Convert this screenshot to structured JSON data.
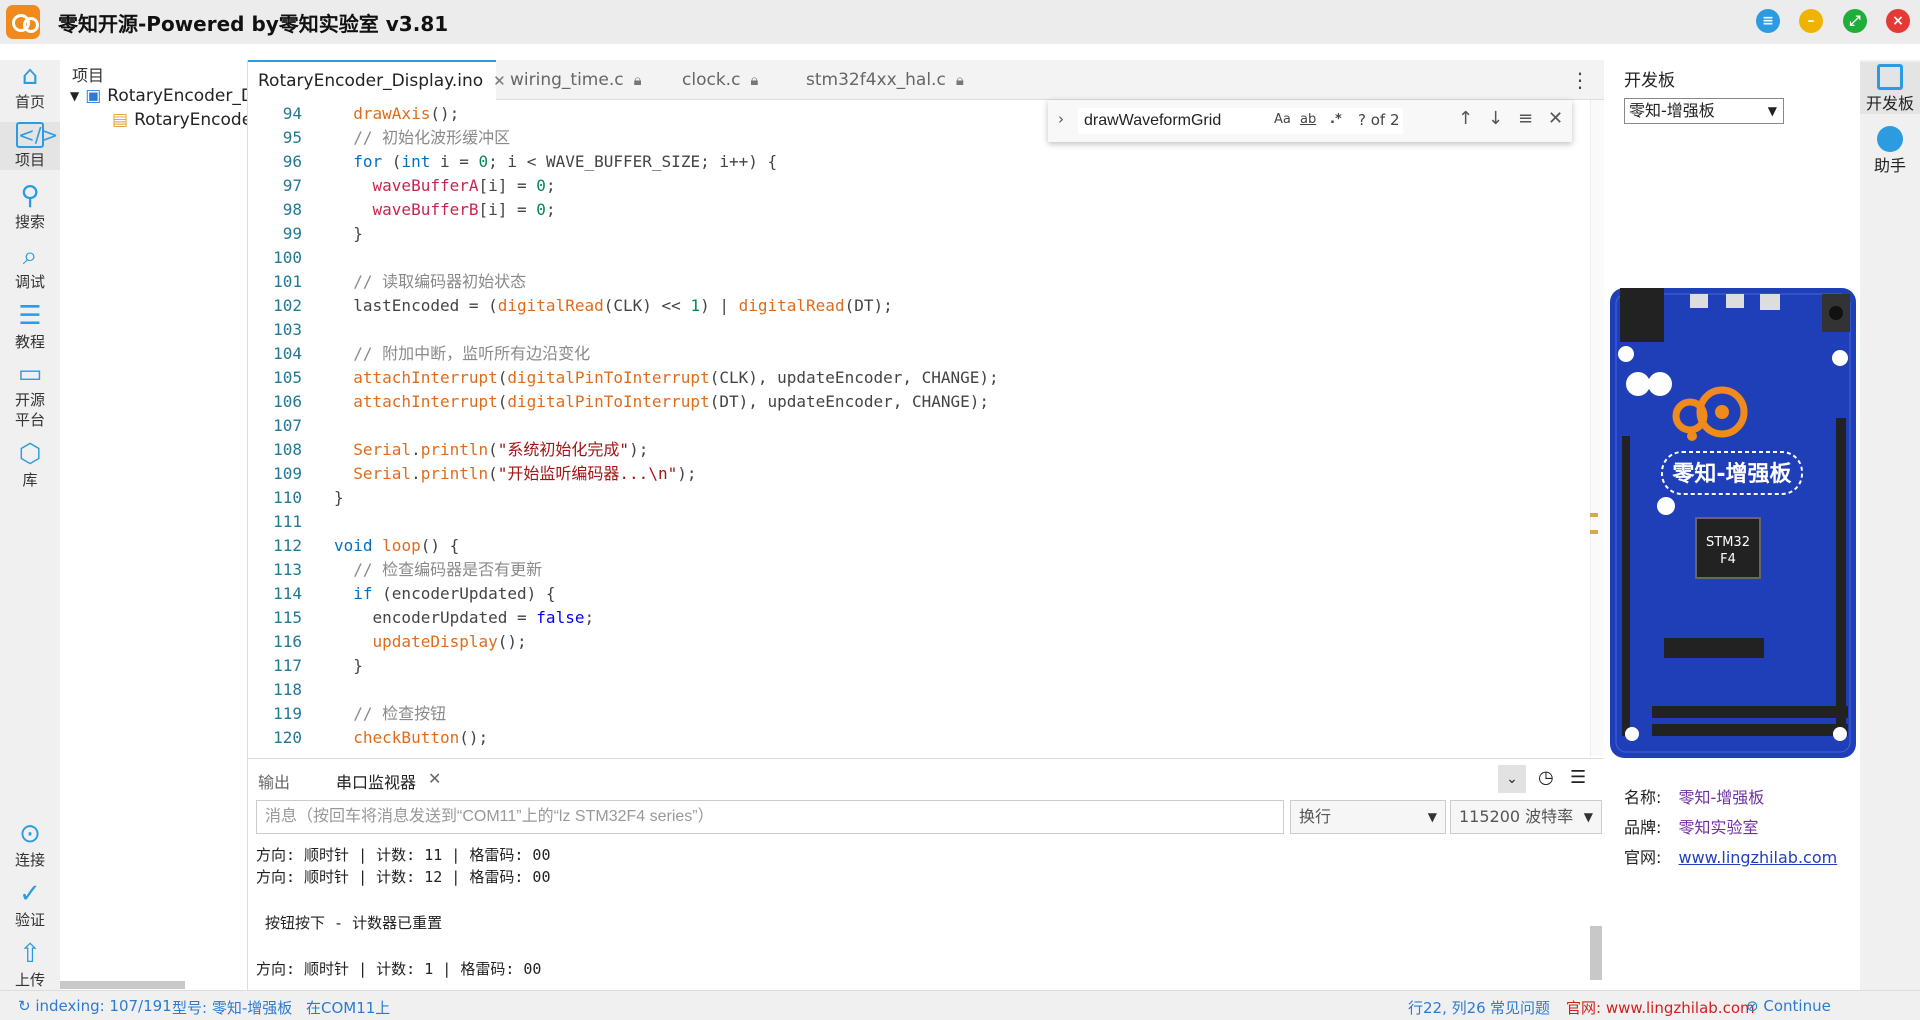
{
  "window": {
    "title": "零知开源-Powered by零知实验室 v3.81"
  },
  "left_nav": {
    "items": [
      {
        "label": "首页",
        "icon": "home-icon"
      },
      {
        "label": "项目",
        "icon": "code-file-icon"
      },
      {
        "label": "搜索",
        "icon": "search-icon"
      },
      {
        "label": "调试",
        "icon": "debug-icon"
      },
      {
        "label": "教程",
        "icon": "list-icon"
      },
      {
        "label": "开源",
        "label2": "平台",
        "icon": "folder-icon"
      },
      {
        "label": "库",
        "icon": "cube-icon"
      }
    ],
    "bottom": [
      {
        "label": "连接",
        "icon": "connect-icon"
      },
      {
        "label": "验证",
        "icon": "check-icon"
      },
      {
        "label": "上传",
        "icon": "upload-icon"
      }
    ]
  },
  "file_tree": {
    "title": "项目",
    "root": "RotaryEncoder_Display",
    "child": "RotaryEncoder_Display.ino"
  },
  "tabs": [
    {
      "label": "RotaryEncoder_Display.ino",
      "active": true,
      "icon": "close-icon"
    },
    {
      "label": "wiring_time.c",
      "active": false,
      "icon": "lock-icon"
    },
    {
      "label": "clock.c",
      "active": false,
      "icon": "lock-icon"
    },
    {
      "label": "stm32f4xx_hal.c",
      "active": false,
      "icon": "lock-icon"
    }
  ],
  "find": {
    "query": "drawWaveformGrid",
    "opt_case": "Aa",
    "opt_word": "ab",
    "opt_regex": ".*",
    "count": "? of 2"
  },
  "code_lines": [
    {
      "n": "94",
      "html": "  <span class='k-fn'>drawAxis</span>();"
    },
    {
      "n": "95",
      "html": "  <span class='k-cm'>// 初始化波形缓冲区</span>"
    },
    {
      "n": "96",
      "html": "  <span class='k-kw'>for</span> (<span class='k-kw'>int</span> i = <span class='k-num'>0</span>; i &lt; WAVE_BUFFER_SIZE; i++) {"
    },
    {
      "n": "97",
      "html": "    <span class='k-var'>waveBufferA</span>[i] = <span class='k-num'>0</span>;"
    },
    {
      "n": "98",
      "html": "    <span class='k-var'>waveBufferB</span>[i] = <span class='k-num'>0</span>;"
    },
    {
      "n": "99",
      "html": "  }"
    },
    {
      "n": "100",
      "html": ""
    },
    {
      "n": "101",
      "html": "  <span class='k-cm'>// 读取编码器初始状态</span>"
    },
    {
      "n": "102",
      "html": "  lastEncoded = (<span class='k-fn'>digitalRead</span>(CLK) &lt;&lt; <span class='k-num'>1</span>) | <span class='k-fn'>digitalRead</span>(DT);"
    },
    {
      "n": "103",
      "html": ""
    },
    {
      "n": "104",
      "html": "  <span class='k-cm'>// 附加中断，监听所有边沿变化</span>"
    },
    {
      "n": "105",
      "html": "  <span class='k-fn'>attachInterrupt</span>(<span class='k-fn'>digitalPinToInterrupt</span>(CLK), updateEncoder, CHANGE);"
    },
    {
      "n": "106",
      "html": "  <span class='k-fn'>attachInterrupt</span>(<span class='k-fn'>digitalPinToInterrupt</span>(DT), updateEncoder, CHANGE);"
    },
    {
      "n": "107",
      "html": ""
    },
    {
      "n": "108",
      "html": "  <span class='k-fn'>Serial</span>.<span class='k-fn'>println</span>(<span class='k-str'>\"系统初始化完成\"</span>);"
    },
    {
      "n": "109",
      "html": "  <span class='k-fn'>Serial</span>.<span class='k-fn'>println</span>(<span class='k-str'>\"开始监听编码器...\\n\"</span>);"
    },
    {
      "n": "110",
      "html": "}"
    },
    {
      "n": "111",
      "html": ""
    },
    {
      "n": "112",
      "html": "<span class='k-kw'>void</span> <span class='k-fn'>loop</span>() {"
    },
    {
      "n": "113",
      "html": "  <span class='k-cm'>// 检查编码器是否有更新</span>"
    },
    {
      "n": "114",
      "html": "  <span class='k-kw'>if</span> (encoderUpdated) {"
    },
    {
      "n": "115",
      "html": "    encoderUpdated = <span class='k-bool'>false</span>;"
    },
    {
      "n": "116",
      "html": "    <span class='k-fn'>updateDisplay</span>();"
    },
    {
      "n": "117",
      "html": "  }"
    },
    {
      "n": "118",
      "html": ""
    },
    {
      "n": "119",
      "html": "  <span class='k-cm'>// 检查按钮</span>"
    },
    {
      "n": "120",
      "html": "  <span class='k-fn'>checkButton</span>();"
    }
  ],
  "bottom_panel": {
    "tab_output": "输出",
    "tab_serial": "串口监视器",
    "input_placeholder": "消息（按回车将消息发送到“COM11”上的“lz STM32F4 series”）",
    "line_ending": "换行",
    "baud": "115200 波特率",
    "lines": [
      "方向: 顺时针 | 计数: 11 | 格雷码: 00",
      "方向: 顺时针 | 计数: 12 | 格雷码: 00",
      "",
      " 按钮按下 - 计数器已重置",
      "",
      "方向: 顺时针 | 计数: 1 | 格雷码: 00"
    ]
  },
  "board_panel": {
    "title": "开发板",
    "selected": "零知-增强板",
    "board_name": "零知-增强板",
    "chip_line1": "STM32",
    "chip_line2": "F4",
    "name_label": "名称:",
    "name_value": "零知-增强板",
    "brand_label": "品牌:",
    "brand_value": "零知实验室",
    "site_label": "官网:",
    "site_value": "www.lingzhilab.com"
  },
  "right_rail": {
    "items": [
      {
        "label": "开发板",
        "icon": "chip-icon"
      },
      {
        "label": "助手",
        "icon": "assistant-icon"
      }
    ]
  },
  "status": {
    "indexing": "indexing: 107/191",
    "model": "型号: 零知-增强板",
    "port": "在COM11上",
    "position": "行22, 列26",
    "faq": "常见问题",
    "site": "官网: www.lingzhilab.com",
    "continue": "Continue"
  },
  "colors": {
    "accent": "#2c9be0",
    "board_blue": "#1f3fb8",
    "title_bar": "#ececec"
  }
}
